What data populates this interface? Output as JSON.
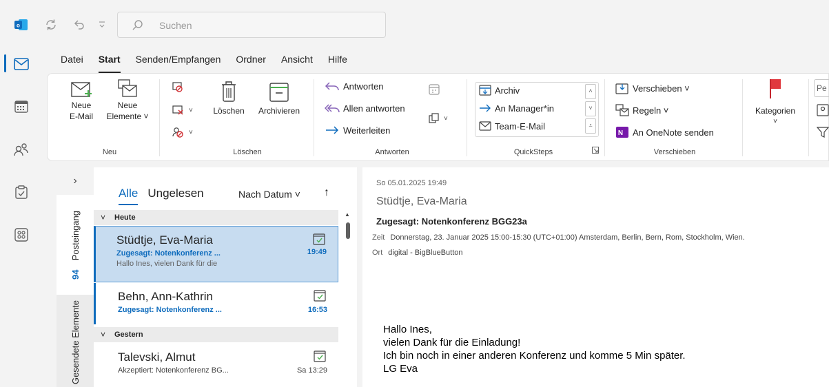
{
  "search": {
    "placeholder": "Suchen"
  },
  "ribbon_tabs": [
    "Datei",
    "Start",
    "Senden/Empfangen",
    "Ordner",
    "Ansicht",
    "Hilfe"
  ],
  "ribbon": {
    "neu": {
      "new_email_l1": "Neue",
      "new_email_l2": "E-Mail",
      "new_items_l1": "Neue",
      "new_items_l2": "Elemente ˅",
      "label": "Neu"
    },
    "loeschen": {
      "delete": "Löschen",
      "archive": "Archivieren",
      "label": "Löschen"
    },
    "antworten": {
      "reply": "Antworten",
      "reply_all": "Allen antworten",
      "forward": "Weiterleiten",
      "label": "Antworten"
    },
    "quicksteps": {
      "items": [
        "Archiv",
        "An Manager*in",
        "Team-E-Mail"
      ],
      "label": "QuickSteps"
    },
    "verschieben": {
      "move": "Verschieben ˅",
      "rules": "Regeln ˅",
      "onenote": "An OneNote senden",
      "label": "Verschieben"
    },
    "kategorien": {
      "label": "Kategorien",
      "chevron": "˅"
    },
    "cut_off_text": "Pe"
  },
  "folders": {
    "expander": "›",
    "inbox_label": "Posteingang",
    "inbox_count": "94",
    "sent_label": "Gesendete Elemente"
  },
  "list": {
    "filter_all": "Alle",
    "filter_unread": "Ungelesen",
    "sort_label": "Nach Datum ˅",
    "sort_direction": "↑",
    "groups": [
      {
        "label": "Heute",
        "chevron": "˅"
      },
      {
        "label": "Gestern",
        "chevron": "˅"
      }
    ],
    "messages": [
      {
        "sender": "Stüdtje, Eva-Maria",
        "subject": "Zugesagt: Notenkonferenz ...",
        "time": "19:49",
        "preview": "Hallo Ines,  vielen Dank für die"
      },
      {
        "sender": "Behn, Ann-Kathrin",
        "subject": "Zugesagt: Notenkonferenz ...",
        "time": "16:53",
        "preview": ""
      },
      {
        "sender": "Talevski, Almut",
        "subject": "Akzeptiert: Notenkonferenz BG...",
        "time": "Sa 13:29",
        "preview": ""
      }
    ]
  },
  "reading": {
    "date": "So 05.01.2025 19:49",
    "from": "Stüdtje, Eva-Maria",
    "subject": "Zugesagt: Notenkonferenz BGG23a",
    "when_label": "Zeit",
    "when_value": "Donnerstag, 23. Januar 2025 15:00-15:30 (UTC+01:00) Amsterdam, Berlin, Bern, Rom, Stockholm, Wien.",
    "where_label": "Ort",
    "where_value": "digital - BigBlueButton",
    "body": [
      "Hallo Ines,",
      "vielen Dank für die Einladung!",
      "Ich bin noch in einer anderen Konferenz und komme 5 Min später.",
      "LG Eva"
    ]
  },
  "colors": {
    "accent": "#0f6cbd",
    "selected_row": "#c7dcf0",
    "flag": "#e0383e",
    "onenote": "#7719aa"
  }
}
